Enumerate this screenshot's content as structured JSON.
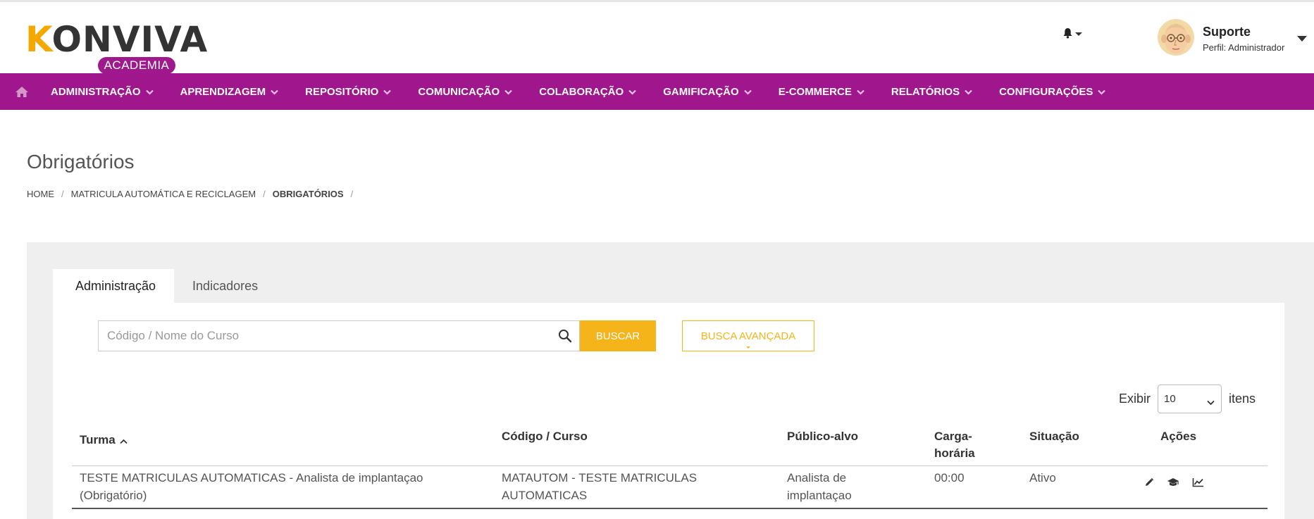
{
  "header": {
    "logo_main": "KONVIVA",
    "logo_sub": "ACADEMIA",
    "user_name": "Suporte",
    "user_role": "Perfil: Administrador"
  },
  "nav": {
    "items": [
      {
        "label": "Administração"
      },
      {
        "label": "Aprendizagem"
      },
      {
        "label": "Repositório"
      },
      {
        "label": "Comunicação"
      },
      {
        "label": "Colaboração"
      },
      {
        "label": "Gamificação"
      },
      {
        "label": "E-commerce"
      },
      {
        "label": "Relatórios"
      },
      {
        "label": "Configurações"
      }
    ]
  },
  "page": {
    "title": "Obrigatórios",
    "breadcrumb": [
      "HOME",
      "MATRICULA AUTOMÁTICA E RECICLAGEM",
      "OBRIGATÓRIOS"
    ]
  },
  "tabs": [
    {
      "label": "Administração",
      "active": true
    },
    {
      "label": "Indicadores",
      "active": false
    }
  ],
  "search": {
    "placeholder": "Código / Nome do Curso",
    "value": "",
    "buscar_label": "Buscar",
    "avancada_label": "Busca avançada"
  },
  "pagination": {
    "exibir_label": "Exibir",
    "per_page": "10",
    "itens_label": "itens"
  },
  "table": {
    "headers": {
      "turma": "Turma",
      "codigo": "Código / Curso",
      "publico_line1": "Público-alvo",
      "carga_line1": "Carga-",
      "carga_line2": "horária",
      "situacao": "Situação",
      "acoes": "Ações"
    },
    "rows": [
      {
        "turma_line1": "TESTE MATRICULAS AUTOMATICAS - Analista de implantaçao",
        "turma_line2": "(Obrigatório)",
        "codigo_line1": "MATAUTOM - TESTE MATRICULAS",
        "codigo_line2": "AUTOMATICAS",
        "publico_line1": "Analista de",
        "publico_line2": "implantaçao",
        "carga": "00:00",
        "situacao": "Ativo"
      }
    ]
  },
  "colors": {
    "brand_purple": "#a0178d",
    "accent_yellow": "#f4b41a"
  },
  "icons": [
    "home-icon",
    "bell-icon",
    "search-icon",
    "edit-icon",
    "graduation-cap-icon",
    "chart-line-icon"
  ]
}
